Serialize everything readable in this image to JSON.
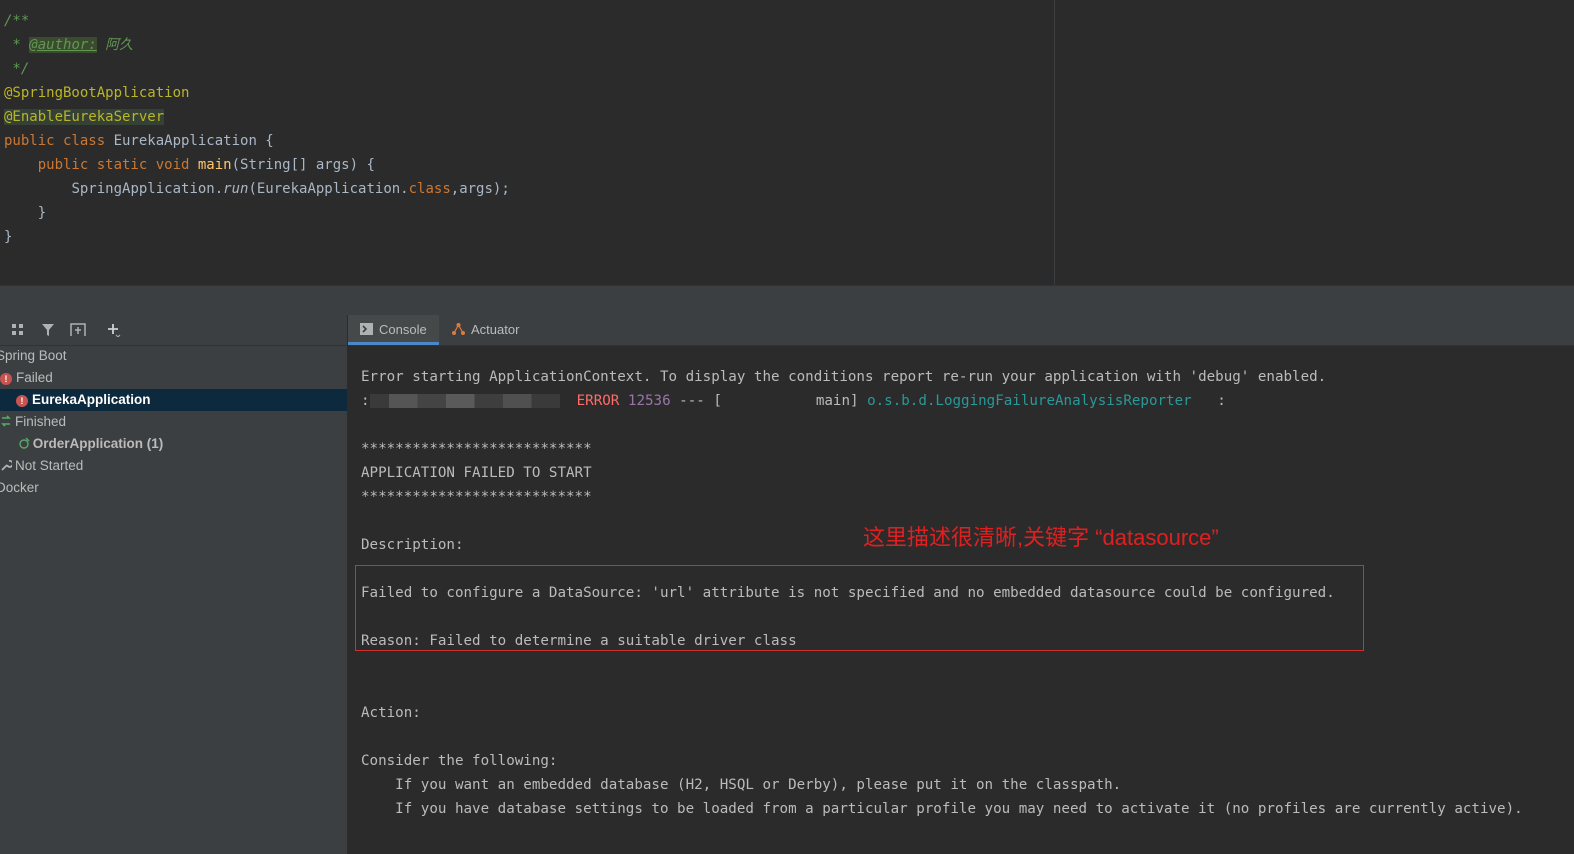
{
  "editor": {
    "lines": [
      {
        "text": "/**"
      },
      {
        "prefix": " * ",
        "tag": "@author:",
        "name": " 阿久"
      },
      {
        "text": " */"
      },
      {
        "ann": "@SpringBootApplication"
      },
      {
        "ann": "@EnableEurekaServer"
      },
      {
        "kw": "public class ",
        "rest": "EurekaApplication {"
      },
      {
        "indent": "    ",
        "kw": "public static void ",
        "fn": "main",
        "rest": "(String[] args) {"
      },
      {
        "indent": "        ",
        "pre": "SpringApplication.",
        "it": "run",
        "mid": "(EurekaApplication.",
        "kw2": "class",
        "post": ",args);"
      },
      {
        "text": "    }"
      },
      {
        "text": "}"
      }
    ]
  },
  "services": {
    "toolbar_icons": [
      "group-icon",
      "filter-icon",
      "pin-tab-icon",
      "add-icon"
    ],
    "tree": {
      "spring_boot": "Spring Boot",
      "failed": "Failed",
      "eureka": "EurekaApplication",
      "finished": "Finished",
      "order": "OrderApplication (1)",
      "not_started": "Not Started",
      "docker": "Docker"
    }
  },
  "console": {
    "tabs": {
      "console": "Console",
      "actuator": "Actuator"
    },
    "line1": "Error starting ApplicationContext. To display the conditions report re-run your application with 'debug' enabled.",
    "line2_level": "ERROR",
    "line2_pid": "12536",
    "line2_sep": " --- [",
    "line2_thread": "           main]",
    "line2_logger": "o.s.b.d.LoggingFailureAnalysisReporter",
    "line2_colon": "   :",
    "stars": "***************************",
    "failed_title": "APPLICATION FAILED TO START",
    "description_label": "Description:",
    "description_text": "Failed to configure a DataSource: 'url' attribute is not specified and no embedded datasource could be configured.",
    "reason": "Reason: Failed to determine a suitable driver class",
    "action_label": "Action:",
    "consider": "Consider the following:",
    "option1": "    If you want an embedded database (H2, HSQL or Derby), please put it on the classpath.",
    "option2": "    If you have database settings to be loaded from a particular profile you may need to activate it (no profiles are currently active)."
  },
  "annotation": "这里描述很清晰,关键字 “datasource”",
  "colors": {
    "error": "#ff6b68",
    "logger": "#299999",
    "highlight_box": "#d03030",
    "selection": "#0d293e"
  }
}
